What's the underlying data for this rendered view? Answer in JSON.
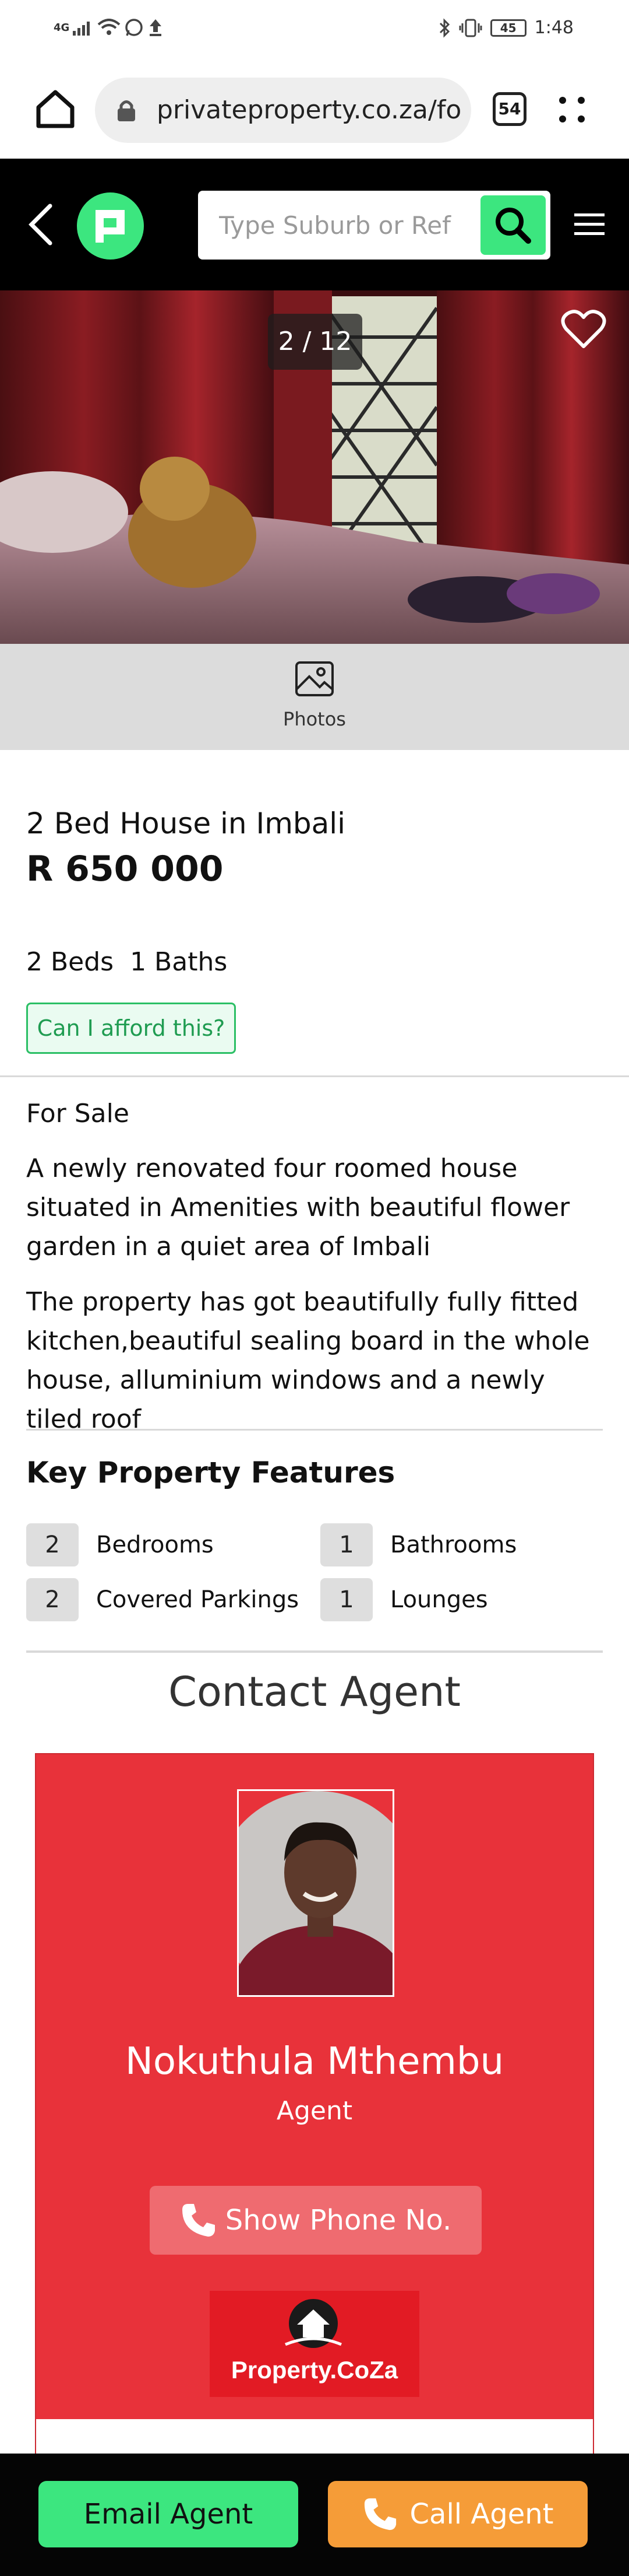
{
  "status_bar": {
    "network": "4G",
    "battery": "45",
    "time": "1:48"
  },
  "browser": {
    "url": "privateproperty.co.za/fo",
    "tab_count": "54"
  },
  "header": {
    "search_placeholder": "Type Suburb or Ref"
  },
  "gallery": {
    "counter": "2 / 12",
    "photos_label": "Photos"
  },
  "listing": {
    "title": "2 Bed House in Imbali",
    "price": "R 650 000",
    "beds_baths": "2 Beds  1 Baths",
    "afford_label": "Can I afford this?",
    "sale_type": "For Sale",
    "description": [
      "A newly renovated four roomed house situated in Amenities with beautiful flower garden in a quiet area of Imbali",
      "The property has got beautifully fully fitted kitchen,beautiful sealing board in the whole house, alluminium windows and a newly tiled roof"
    ]
  },
  "features": {
    "title": "Key Property Features",
    "items": [
      {
        "count": "2",
        "label": "Bedrooms"
      },
      {
        "count": "1",
        "label": "Bathrooms"
      },
      {
        "count": "2",
        "label": "Covered Parkings"
      },
      {
        "count": "1",
        "label": "Lounges"
      }
    ]
  },
  "contact": {
    "title": "Contact Agent",
    "agent_name": "Nokuthula Mthembu",
    "agent_role": "Agent",
    "phone_label": "Show Phone No.",
    "agency_name": "Property.CoZa"
  },
  "actions": {
    "email_label": "Email Agent",
    "call_label": "Call Agent"
  },
  "colors": {
    "brand_green": "#3ce67f",
    "agent_card_red": "#e8323a",
    "call_orange": "#f59c38"
  }
}
